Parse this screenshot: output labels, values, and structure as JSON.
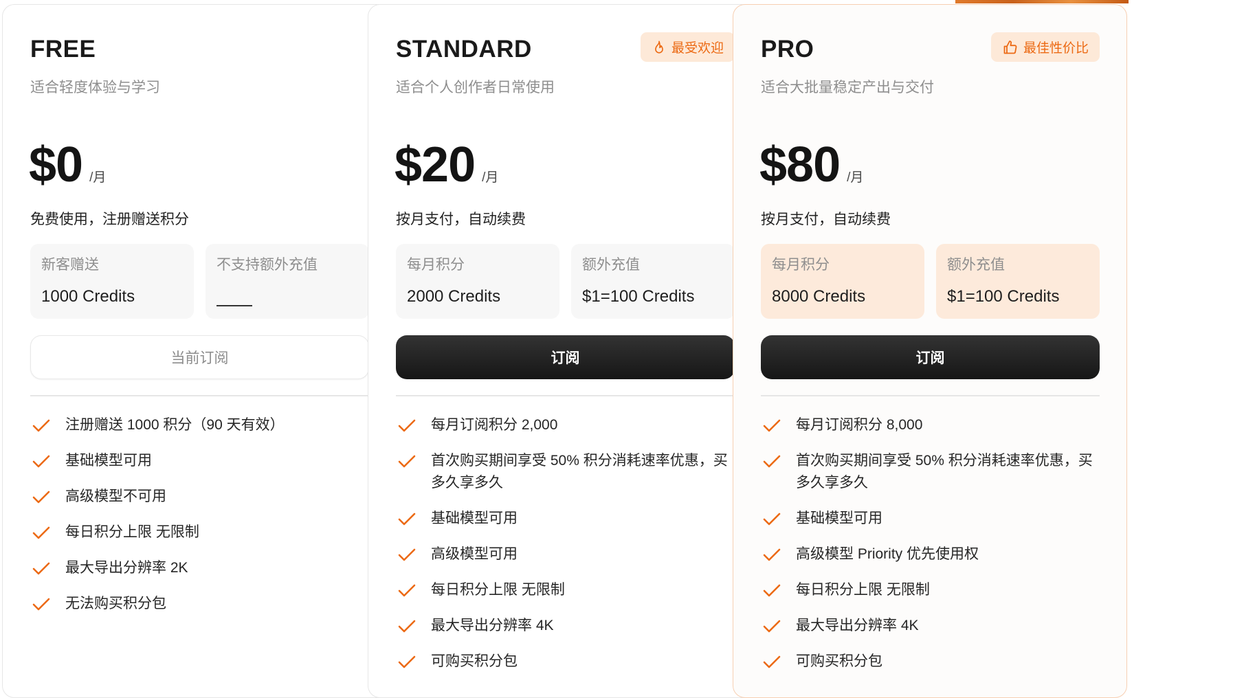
{
  "plans": [
    {
      "name": "FREE",
      "subtitle": "适合轻度体验与学习",
      "price": "$0",
      "price_unit": "/月",
      "billing_note": "免费使用，注册赠送积分",
      "box1": {
        "label": "新客赠送",
        "value": "1000 Credits"
      },
      "box2": {
        "label": "不支持额外充值",
        "value": "——"
      },
      "button_label": "当前订阅",
      "features": [
        "注册赠送 1000 积分（90 天有效）",
        "基础模型可用",
        "高级模型不可用",
        "每日积分上限 无限制",
        "最大导出分辨率 2K",
        "无法购买积分包"
      ]
    },
    {
      "name": "STANDARD",
      "subtitle": "适合个人创作者日常使用",
      "badge": "最受欢迎",
      "badge_icon": "fire-icon",
      "price": "$20",
      "price_unit": "/月",
      "billing_note": "按月支付，自动续费",
      "box1": {
        "label": "每月积分",
        "value": "2000 Credits"
      },
      "box2": {
        "label": "额外充值",
        "value": "$1=100 Credits"
      },
      "button_label": "订阅",
      "features": [
        "每月订阅积分 2,000",
        "首次购买期间享受 50% 积分消耗速率优惠，买多久享多久",
        "基础模型可用",
        "高级模型可用",
        "每日积分上限 无限制",
        "最大导出分辨率 4K",
        "可购买积分包"
      ]
    },
    {
      "name": "PRO",
      "subtitle": "适合大批量稳定产出与交付",
      "badge": "最佳性价比",
      "badge_icon": "thumbs-up-icon",
      "price": "$80",
      "price_unit": "/月",
      "billing_note": "按月支付，自动续费",
      "box1": {
        "label": "每月积分",
        "value": "8000 Credits"
      },
      "box2": {
        "label": "额外充值",
        "value": "$1=100 Credits"
      },
      "button_label": "订阅",
      "features": [
        "每月订阅积分 8,000",
        "首次购买期间享受 50% 积分消耗速率优惠，买多久享多久",
        "基础模型可用",
        "高级模型 Priority 优先使用权",
        "每日积分上限 无限制",
        "最大导出分辨率 4K",
        "可购买积分包"
      ]
    }
  ],
  "colors": {
    "accent": "#ec6a14",
    "badge_bg": "#fde9d8",
    "pro_box_bg": "#fdeadb",
    "dark_button": "#1c1c1c"
  }
}
